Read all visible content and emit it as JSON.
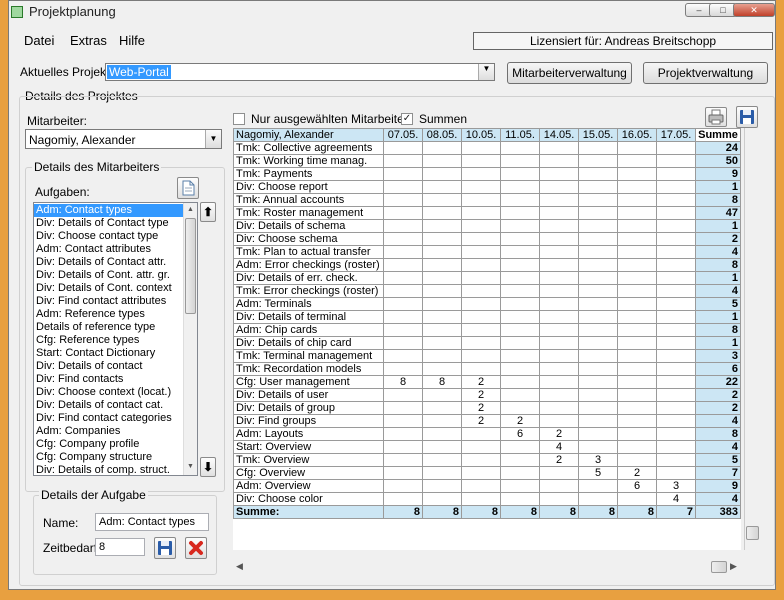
{
  "window": {
    "title": "Projektplanung"
  },
  "menu": {
    "items": [
      "Datei",
      "Extras",
      "Hilfe"
    ],
    "license": "Lizensiert für: Andreas Breitschopp"
  },
  "project": {
    "label": "Aktuelles Projekt:",
    "value": "Web-Portal",
    "btn_staff": "Mitarbeiterverwaltung",
    "btn_projects": "Projektverwaltung"
  },
  "details": {
    "title": "Details des Projektes",
    "staff_label": "Mitarbeiter:",
    "staff_value": "Nagomiy, Alexander",
    "staff_group": "Details des Mitarbeiters",
    "tasks_label": "Aufgaben:",
    "tasks": [
      "Adm: Contact types",
      "Div: Details of Contact type",
      "Div: Choose contact type",
      "Adm: Contact attributes",
      "Div: Details of Contact attr.",
      "Div: Details of Cont. attr. gr.",
      "Div: Details of Cont. context",
      "Div: Find contact attributes",
      "Adm: Reference types",
      "Details of reference type",
      "Cfg: Reference types",
      "Start: Contact Dictionary",
      "Div: Details of contact",
      "Div: Find contacts",
      "Div: Choose context (locat.)",
      "Div: Details of contact cat.",
      "Div: Find contact categories",
      "Adm: Companies",
      "Cfg: Company profile",
      "Cfg: Company structure",
      "Div: Details of comp. struct."
    ],
    "task_group": "Details der Aufgabe",
    "name_label": "Name:",
    "name_value": "Adm: Contact types",
    "time_label": "Zeitbedarf:",
    "time_value": "8"
  },
  "filters": {
    "only_selected": "Nur ausgewählten Mitarbeiter",
    "sums": "Summen",
    "sums_check": "✓"
  },
  "grid": {
    "name": "Nagomiy, Alexander",
    "dates": [
      "07.05.",
      "08.05.",
      "10.05.",
      "11.05.",
      "14.05.",
      "15.05.",
      "16.05.",
      "17.05."
    ],
    "sum_header": "Summe",
    "rows": [
      {
        "task": "Tmk: Collective agreements",
        "cells": [
          "",
          "",
          "",
          "",
          "",
          "",
          "",
          ""
        ],
        "sum": "24"
      },
      {
        "task": "Tmk: Working time manag.",
        "cells": [
          "",
          "",
          "",
          "",
          "",
          "",
          "",
          ""
        ],
        "sum": "50"
      },
      {
        "task": "Tmk: Payments",
        "cells": [
          "",
          "",
          "",
          "",
          "",
          "",
          "",
          ""
        ],
        "sum": "9"
      },
      {
        "task": "Div: Choose report",
        "cells": [
          "",
          "",
          "",
          "",
          "",
          "",
          "",
          ""
        ],
        "sum": "1"
      },
      {
        "task": "Tmk: Annual accounts",
        "cells": [
          "",
          "",
          "",
          "",
          "",
          "",
          "",
          ""
        ],
        "sum": "8"
      },
      {
        "task": "Tmk: Roster management",
        "cells": [
          "",
          "",
          "",
          "",
          "",
          "",
          "",
          ""
        ],
        "sum": "47"
      },
      {
        "task": "Div: Details of schema",
        "cells": [
          "",
          "",
          "",
          "",
          "",
          "",
          "",
          ""
        ],
        "sum": "1"
      },
      {
        "task": "Div: Choose schema",
        "cells": [
          "",
          "",
          "",
          "",
          "",
          "",
          "",
          ""
        ],
        "sum": "2"
      },
      {
        "task": "Tmk: Plan to actual transfer",
        "cells": [
          "",
          "",
          "",
          "",
          "",
          "",
          "",
          ""
        ],
        "sum": "4"
      },
      {
        "task": "Adm: Error checkings (roster)",
        "cells": [
          "",
          "",
          "",
          "",
          "",
          "",
          "",
          ""
        ],
        "sum": "8"
      },
      {
        "task": "Div: Details of err. check.",
        "cells": [
          "",
          "",
          "",
          "",
          "",
          "",
          "",
          ""
        ],
        "sum": "1"
      },
      {
        "task": "Tmk: Error checkings (roster)",
        "cells": [
          "",
          "",
          "",
          "",
          "",
          "",
          "",
          ""
        ],
        "sum": "4"
      },
      {
        "task": "Adm: Terminals",
        "cells": [
          "",
          "",
          "",
          "",
          "",
          "",
          "",
          ""
        ],
        "sum": "5"
      },
      {
        "task": "Div: Details of terminal",
        "cells": [
          "",
          "",
          "",
          "",
          "",
          "",
          "",
          ""
        ],
        "sum": "1"
      },
      {
        "task": "Adm: Chip cards",
        "cells": [
          "",
          "",
          "",
          "",
          "",
          "",
          "",
          ""
        ],
        "sum": "8"
      },
      {
        "task": "Div: Details of chip card",
        "cells": [
          "",
          "",
          "",
          "",
          "",
          "",
          "",
          ""
        ],
        "sum": "1"
      },
      {
        "task": "Tmk: Terminal management",
        "cells": [
          "",
          "",
          "",
          "",
          "",
          "",
          "",
          ""
        ],
        "sum": "3"
      },
      {
        "task": "Tmk: Recordation models",
        "cells": [
          "",
          "",
          "",
          "",
          "",
          "",
          "",
          ""
        ],
        "sum": "6"
      },
      {
        "task": "Cfg: User management",
        "cells": [
          "8",
          "8",
          "2",
          "",
          "",
          "",
          "",
          ""
        ],
        "sum": "22"
      },
      {
        "task": "Div: Details of user",
        "cells": [
          "",
          "",
          "2",
          "",
          "",
          "",
          "",
          ""
        ],
        "sum": "2"
      },
      {
        "task": "Div: Details of group",
        "cells": [
          "",
          "",
          "2",
          "",
          "",
          "",
          "",
          ""
        ],
        "sum": "2"
      },
      {
        "task": "Div: Find groups",
        "cells": [
          "",
          "",
          "2",
          "2",
          "",
          "",
          "",
          ""
        ],
        "sum": "4"
      },
      {
        "task": "Adm: Layouts",
        "cells": [
          "",
          "",
          "",
          "6",
          "2",
          "",
          "",
          ""
        ],
        "sum": "8"
      },
      {
        "task": "Start: Overview",
        "cells": [
          "",
          "",
          "",
          "",
          "4",
          "",
          "",
          ""
        ],
        "sum": "4"
      },
      {
        "task": "Tmk: Overview",
        "cells": [
          "",
          "",
          "",
          "",
          "2",
          "3",
          "",
          ""
        ],
        "sum": "5"
      },
      {
        "task": "Cfg: Overview",
        "cells": [
          "",
          "",
          "",
          "",
          "",
          "5",
          "2",
          ""
        ],
        "sum": "7"
      },
      {
        "task": "Adm: Overview",
        "cells": [
          "",
          "",
          "",
          "",
          "",
          "",
          "6",
          "3"
        ],
        "sum": "9"
      },
      {
        "task": "Div: Choose color",
        "cells": [
          "",
          "",
          "",
          "",
          "",
          "",
          "",
          "4"
        ],
        "sum": "4"
      }
    ],
    "footer": {
      "label": "Summe:",
      "values": [
        "8",
        "8",
        "8",
        "8",
        "8",
        "8",
        "8",
        "7"
      ],
      "sum": "383"
    }
  }
}
